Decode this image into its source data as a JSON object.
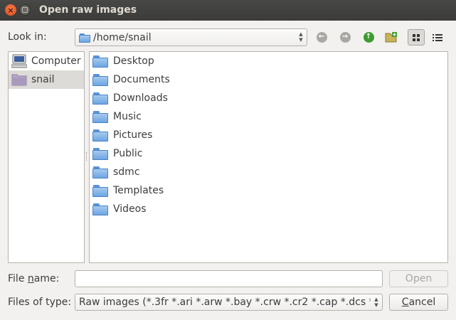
{
  "window": {
    "title": "Open raw images"
  },
  "lookin": {
    "label": "Look in:",
    "path": "/home/snail"
  },
  "sidebar": {
    "items": [
      {
        "label": "Computer",
        "icon": "computer-icon",
        "selected": false
      },
      {
        "label": "snail",
        "icon": "home-folder-icon",
        "selected": true
      }
    ]
  },
  "files": [
    {
      "name": "Desktop",
      "icon": "folder-icon"
    },
    {
      "name": "Documents",
      "icon": "folder-icon"
    },
    {
      "name": "Downloads",
      "icon": "folder-icon"
    },
    {
      "name": "Music",
      "icon": "folder-icon"
    },
    {
      "name": "Pictures",
      "icon": "folder-icon"
    },
    {
      "name": "Public",
      "icon": "folder-icon"
    },
    {
      "name": "sdmc",
      "icon": "folder-icon"
    },
    {
      "name": "Templates",
      "icon": "folder-icon"
    },
    {
      "name": "Videos",
      "icon": "folder-icon"
    }
  ],
  "filename": {
    "label_pre": "File ",
    "label_ul": "n",
    "label_post": "ame:",
    "value": "",
    "placeholder": ""
  },
  "filetype": {
    "label": "Files of type:",
    "value": "Raw images (*.3fr *.ari *.arw *.bay *.crw *.cr2 *.cap *.dcs *.dc"
  },
  "buttons": {
    "open": "Open",
    "cancel_ul": "C",
    "cancel_rest": "ancel"
  },
  "colors": {
    "titlebar": "#3c3b37",
    "close": "#df4a16",
    "folder": "#6ea5e2",
    "up_arrow": "#3d9b2f"
  }
}
